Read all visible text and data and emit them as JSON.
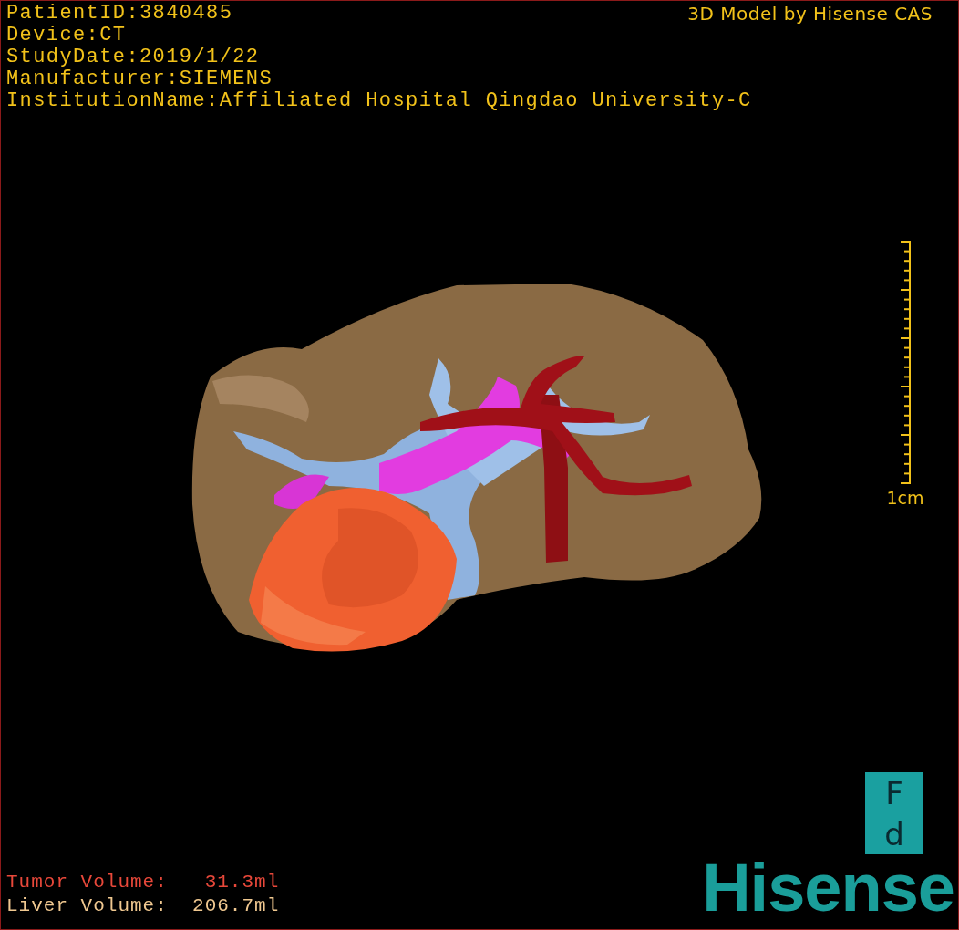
{
  "study_info": [
    {
      "label": "PatientID:",
      "value": "3840485"
    },
    {
      "label": "Device:",
      "value": "CT"
    },
    {
      "label": "StudyDate:",
      "value": "2019/1/22"
    },
    {
      "label": "Manufacturer:",
      "value": "SIEMENS"
    },
    {
      "label": "InstitutionName:",
      "value": "Affiliated Hospital Qingdao University-C"
    }
  ],
  "viewer_title": "3D Model by Hisense CAS",
  "scale_bar": {
    "label": "1cm"
  },
  "volumes": [
    {
      "label": "Tumor Volume:",
      "value": "31.3ml",
      "color": "#e8483a"
    },
    {
      "label": "Liver Volume:",
      "value": "206.7ml",
      "color": "#f0c890"
    }
  ],
  "orientation_cube": {
    "top": "F",
    "bottom": "d"
  },
  "logo": "Hisense"
}
